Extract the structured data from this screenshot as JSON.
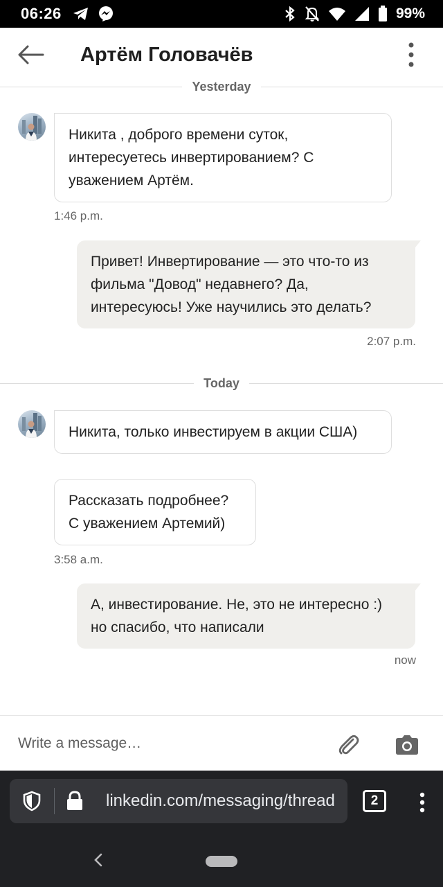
{
  "status_bar": {
    "time": "06:26",
    "battery": "99%",
    "left_icons": [
      "telegram-icon",
      "messenger-icon"
    ],
    "right_icons": [
      "bluetooth-icon",
      "notifications-off-icon",
      "wifi-icon",
      "signal-icon",
      "battery-icon"
    ]
  },
  "header": {
    "title": "Артём Головачёв"
  },
  "messages": {
    "divider_yesterday": "Yesterday",
    "divider_today": "Today",
    "m1_text": "Никита , доброго времени суток, интересуетесь инвертированием? С уважением Артём.",
    "m1_time": "1:46 p.m.",
    "m2_text": "Привет! Инвертирование — это что-то из фильма \"Довод\" недавнего? Да, интересуюсь! Уже научились это делать?",
    "m2_time": "2:07 p.m.",
    "m3_text": "Никита, только инвестируем в акции США)",
    "m4_text": "Рассказать подробнее? С уважением Артемий)",
    "m4_time": "3:58 a.m.",
    "m5_text": "А, инвестирование. Не, это не интересно :) но спасибо, что написали",
    "m5_time": "now"
  },
  "composer": {
    "placeholder": "Write a message…"
  },
  "browser": {
    "url": "linkedin.com/messaging/thread",
    "tab_count": "2"
  }
}
